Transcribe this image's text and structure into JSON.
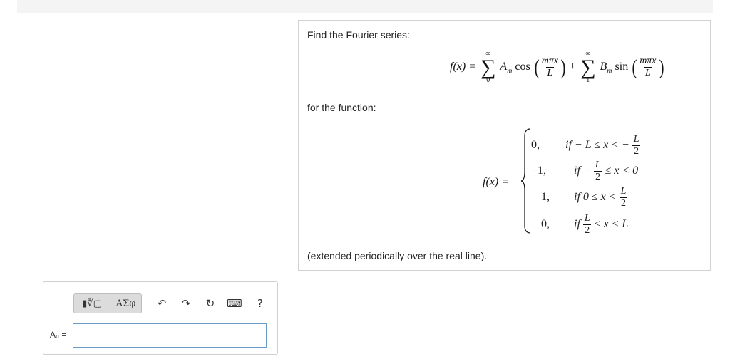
{
  "problem": {
    "intro": "Find the Fourier series:",
    "for_function": "for the function:",
    "extended": "(extended periodically over the real line)."
  },
  "series_formula": {
    "lhs": "f(x) =",
    "sum1_upper": "∞",
    "sum1_lower": "0",
    "coef_a": "A",
    "coef_a_sub": "m",
    "cos": "cos",
    "plus": "+",
    "sum2_upper": "∞",
    "sum2_lower": "1",
    "coef_b": "B",
    "coef_b_sub": "m",
    "sin": "sin",
    "frac_num": "mπx",
    "frac_den": "L"
  },
  "piecewise": {
    "lhs": "f(x) =",
    "rows": [
      {
        "value": "0,",
        "condition": "if  − L ≤ x < −",
        "frac_num": "L",
        "frac_den": "2",
        "after": ""
      },
      {
        "value": "−1,",
        "condition": "if  −",
        "frac_num": "L",
        "frac_den": "2",
        "after": "≤ x < 0"
      },
      {
        "value": "1,",
        "condition": "if  0 ≤ x <",
        "frac_num": "L",
        "frac_den": "2",
        "after": ""
      },
      {
        "value": "0,",
        "condition": "if ",
        "frac_num": "L",
        "frac_den": "2",
        "after": "≤ x < L"
      }
    ]
  },
  "toolbar": {
    "templates_label": "▮∜▢",
    "symbols_label": "ΑΣφ",
    "undo_glyph": "↶",
    "redo_glyph": "↷",
    "reset_glyph": "↻",
    "keyboard_glyph": "⌨",
    "help_glyph": "?"
  },
  "answer": {
    "label": "A₀ =",
    "value": ""
  }
}
